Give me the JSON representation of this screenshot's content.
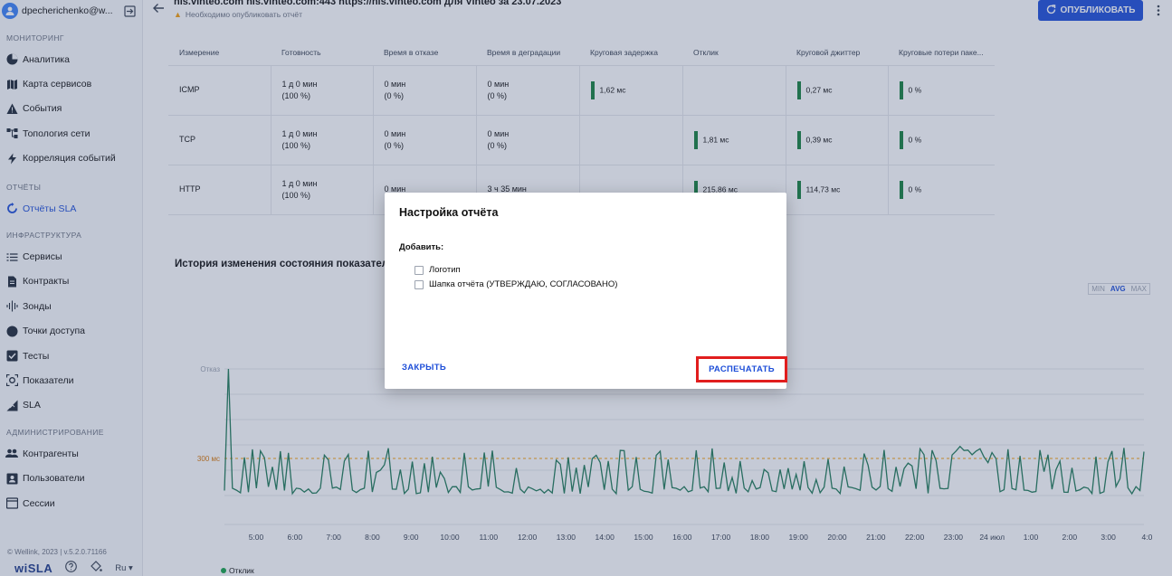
{
  "sidebar": {
    "user_name": "dpecherichenko@w...",
    "sections": [
      {
        "title": "МОНИТОРИНГ",
        "items": [
          {
            "label": "Аналитика",
            "icon": "pie-chart-icon"
          },
          {
            "label": "Карта сервисов",
            "icon": "map-icon"
          },
          {
            "label": "События",
            "icon": "warning-icon"
          },
          {
            "label": "Топология сети",
            "icon": "topology-icon"
          },
          {
            "label": "Корреляция событий",
            "icon": "bolt-icon"
          }
        ]
      },
      {
        "title": "ОТЧЁТЫ",
        "items": [
          {
            "label": "Отчёты SLA",
            "icon": "refresh-icon",
            "active": true
          }
        ]
      },
      {
        "title": "ИНФРАСТРУКТУРА",
        "items": [
          {
            "label": "Сервисы",
            "icon": "list-icon"
          },
          {
            "label": "Контракты",
            "icon": "document-icon"
          },
          {
            "label": "Зонды",
            "icon": "signal-icon"
          },
          {
            "label": "Точки доступа",
            "icon": "circle-icon"
          },
          {
            "label": "Тесты",
            "icon": "checkbox-icon"
          },
          {
            "label": "Показатели",
            "icon": "target-icon"
          },
          {
            "label": "SLA",
            "icon": "sla-icon"
          }
        ]
      },
      {
        "title": "АДМИНИСТРИРОВАНИЕ",
        "items": [
          {
            "label": "Контрагенты",
            "icon": "people-icon"
          },
          {
            "label": "Пользователи",
            "icon": "user-card-icon"
          },
          {
            "label": "Сессии",
            "icon": "window-icon"
          }
        ]
      }
    ],
    "copyright": "© Wellink, 2023 | v.5.2.0.71166",
    "brand": "wiSLA",
    "lang": "Ru"
  },
  "header": {
    "title": "nis.vinteo.com nis.vinteo.com:443 https://nis.vinteo.com для Vinteo за 23.07.2023",
    "warning": "Необходимо опубликовать отчёт",
    "publish_label": "ОПУБЛИКОВАТЬ"
  },
  "table": {
    "headers": [
      "Измерение",
      "Готовность",
      "Время в отказе",
      "Время в деградации",
      "Круговая задержка",
      "Отклик",
      "Круговой джиттер",
      "Круговые потери паке..."
    ],
    "rows": [
      {
        "name": "ICMP",
        "ready": [
          "1 д 0 мин",
          "(100 %)"
        ],
        "fail": [
          "0 мин",
          "(0 %)"
        ],
        "degr": [
          "0 мин",
          "(0 %)"
        ],
        "delay": "1,62 мс",
        "resp": "",
        "jitter": "0,27 мс",
        "loss": "0 %"
      },
      {
        "name": "TCP",
        "ready": [
          "1 д 0 мин",
          "(100 %)"
        ],
        "fail": [
          "0 мин",
          "(0 %)"
        ],
        "degr": [
          "0 мин",
          "(0 %)"
        ],
        "delay": "",
        "resp": "1,81 мс",
        "jitter": "0,39 мс",
        "loss": "0 %"
      },
      {
        "name": "HTTP",
        "ready": [
          "1 д 0 мин",
          "(100 %)"
        ],
        "fail": [
          "0 мин",
          ""
        ],
        "degr": [
          "3 ч 35 мин",
          ""
        ],
        "delay": "",
        "resp": "215,86 мс",
        "jitter": "114,73 мс",
        "loss": "0 %"
      }
    ]
  },
  "history": {
    "title": "История изменения состояния показателя",
    "modes": [
      "MIN",
      "AVG",
      "MAX"
    ],
    "active_mode": "AVG",
    "legend": "Отклик",
    "y_labels": [
      "Отказ",
      "300 мс"
    ],
    "x_labels": [
      "5:00",
      "6:00",
      "7:00",
      "8:00",
      "9:00",
      "10:00",
      "11:00",
      "12:00",
      "13:00",
      "14:00",
      "15:00",
      "16:00",
      "17:00",
      "18:00",
      "19:00",
      "20:00",
      "21:00",
      "22:00",
      "23:00",
      "24 июл",
      "1:00",
      "2:00",
      "3:00",
      "4:0"
    ],
    "line_color": "#1f7a57"
  },
  "modal": {
    "title": "Настройка отчёта",
    "add_label": "Добавить:",
    "options": [
      "Логотип",
      "Шапка отчёта (УТВЕРЖДАЮ, СОГЛАСОВАНО)"
    ],
    "close_label": "ЗАКРЫТЬ",
    "print_label": "РАСПЕЧАТАТЬ"
  }
}
